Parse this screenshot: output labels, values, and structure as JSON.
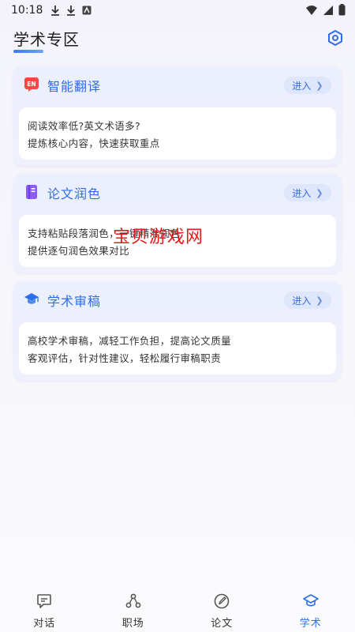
{
  "status_bar": {
    "time": "10:18",
    "icons_left": [
      "download-icon",
      "download-icon",
      "app-icon"
    ],
    "icons_right": [
      "wifi-icon",
      "signal-icon",
      "battery-icon"
    ]
  },
  "header": {
    "title": "学术专区",
    "settings_icon": "settings-hex-icon"
  },
  "cards": [
    {
      "icon": "translate-en-icon",
      "title": "智能翻译",
      "enter_label": "进入",
      "lines": [
        "阅读效率低?英文术语多?",
        "提炼核心内容，快速获取重点"
      ]
    },
    {
      "icon": "book-icon",
      "title": "论文润色",
      "enter_label": "进入",
      "lines": [
        "支持粘贴段落润色，一键精准润色",
        "提供逐句润色效果对比"
      ]
    },
    {
      "icon": "graduation-cap-icon",
      "title": "学术审稿",
      "enter_label": "进入",
      "lines": [
        "高校学术审稿，减轻工作负担，提高论文质量",
        "客观评估，针对性建议，轻松履行审稿职责"
      ]
    }
  ],
  "watermark": "宝贝游戏网",
  "bottom_nav": [
    {
      "label": "对话",
      "icon": "chat-icon",
      "active": false
    },
    {
      "label": "职场",
      "icon": "workplace-icon",
      "active": false
    },
    {
      "label": "论文",
      "icon": "pen-icon",
      "active": false
    },
    {
      "label": "学术",
      "icon": "graduation-cap-icon",
      "active": true
    }
  ],
  "colors": {
    "accent": "#2f6ee8",
    "card_bg": "#eceffd",
    "enter_bg": "#dde6fb",
    "watermark": "#e41b1b"
  }
}
